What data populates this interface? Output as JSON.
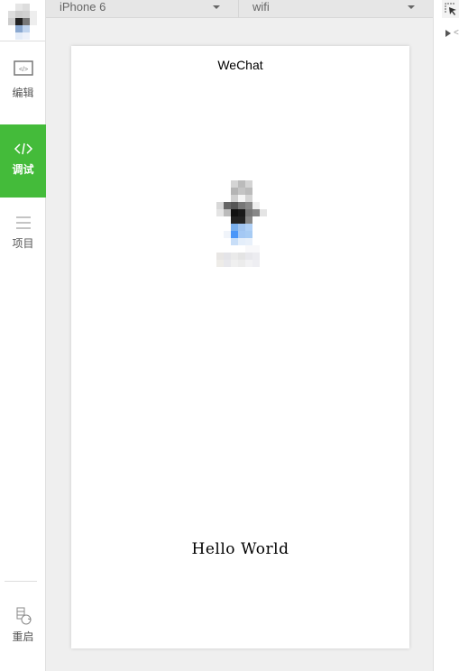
{
  "sidebar": {
    "items": [
      {
        "label": "编辑",
        "icon": "code-window-icon",
        "active": false
      },
      {
        "label": "调试",
        "icon": "code-icon",
        "active": true
      },
      {
        "label": "项目",
        "icon": "menu-icon",
        "active": false
      }
    ],
    "bottom": {
      "label": "重启",
      "icon": "restart-icon"
    },
    "active_color": "#44bb3a"
  },
  "toolbar": {
    "device": "iPhone 6",
    "network": "wifi"
  },
  "phone": {
    "nav_title": "WeChat",
    "text": "Hello World"
  }
}
